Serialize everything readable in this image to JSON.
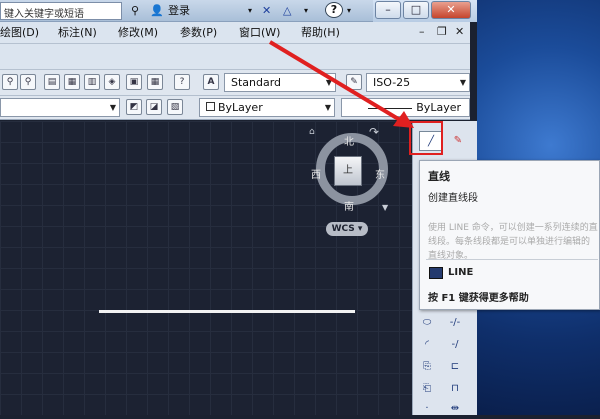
{
  "titlebar": {
    "search_placeholder": "键入关键字或短语",
    "login_label": "登录",
    "help_label": "?"
  },
  "window_controls": {
    "minimize": "–",
    "maximize": "□",
    "close": "✕"
  },
  "menubar": {
    "items": [
      {
        "label": "绘图(D)"
      },
      {
        "label": "标注(N)"
      },
      {
        "label": "修改(M)"
      },
      {
        "label": "参数(P)"
      },
      {
        "label": "窗口(W)"
      },
      {
        "label": "帮助(H)"
      }
    ]
  },
  "mdi_controls": {
    "minimize": "–",
    "restore": "❐",
    "close": "✕"
  },
  "toolbar1": {
    "text_style": "Standard",
    "dim_style": "ISO-25"
  },
  "toolbar2": {
    "layer": "ByLayer",
    "linetype": "ByLayer"
  },
  "viewcube": {
    "north": "北",
    "south": "南",
    "east": "东",
    "west": "西",
    "face": "上",
    "wcs_label": "WCS"
  },
  "tooltip": {
    "title": "直线",
    "description": "创建直线段",
    "details": "使用 LINE 命令，可以创建一系列连续的直线段。每条线段都是可以单独进行编辑的直线对象。",
    "command": "LINE",
    "help_hint": "按 F1 键获得更多帮助"
  },
  "colors": {
    "accent": "#e02020",
    "canvas_bg": "#1c2232"
  }
}
